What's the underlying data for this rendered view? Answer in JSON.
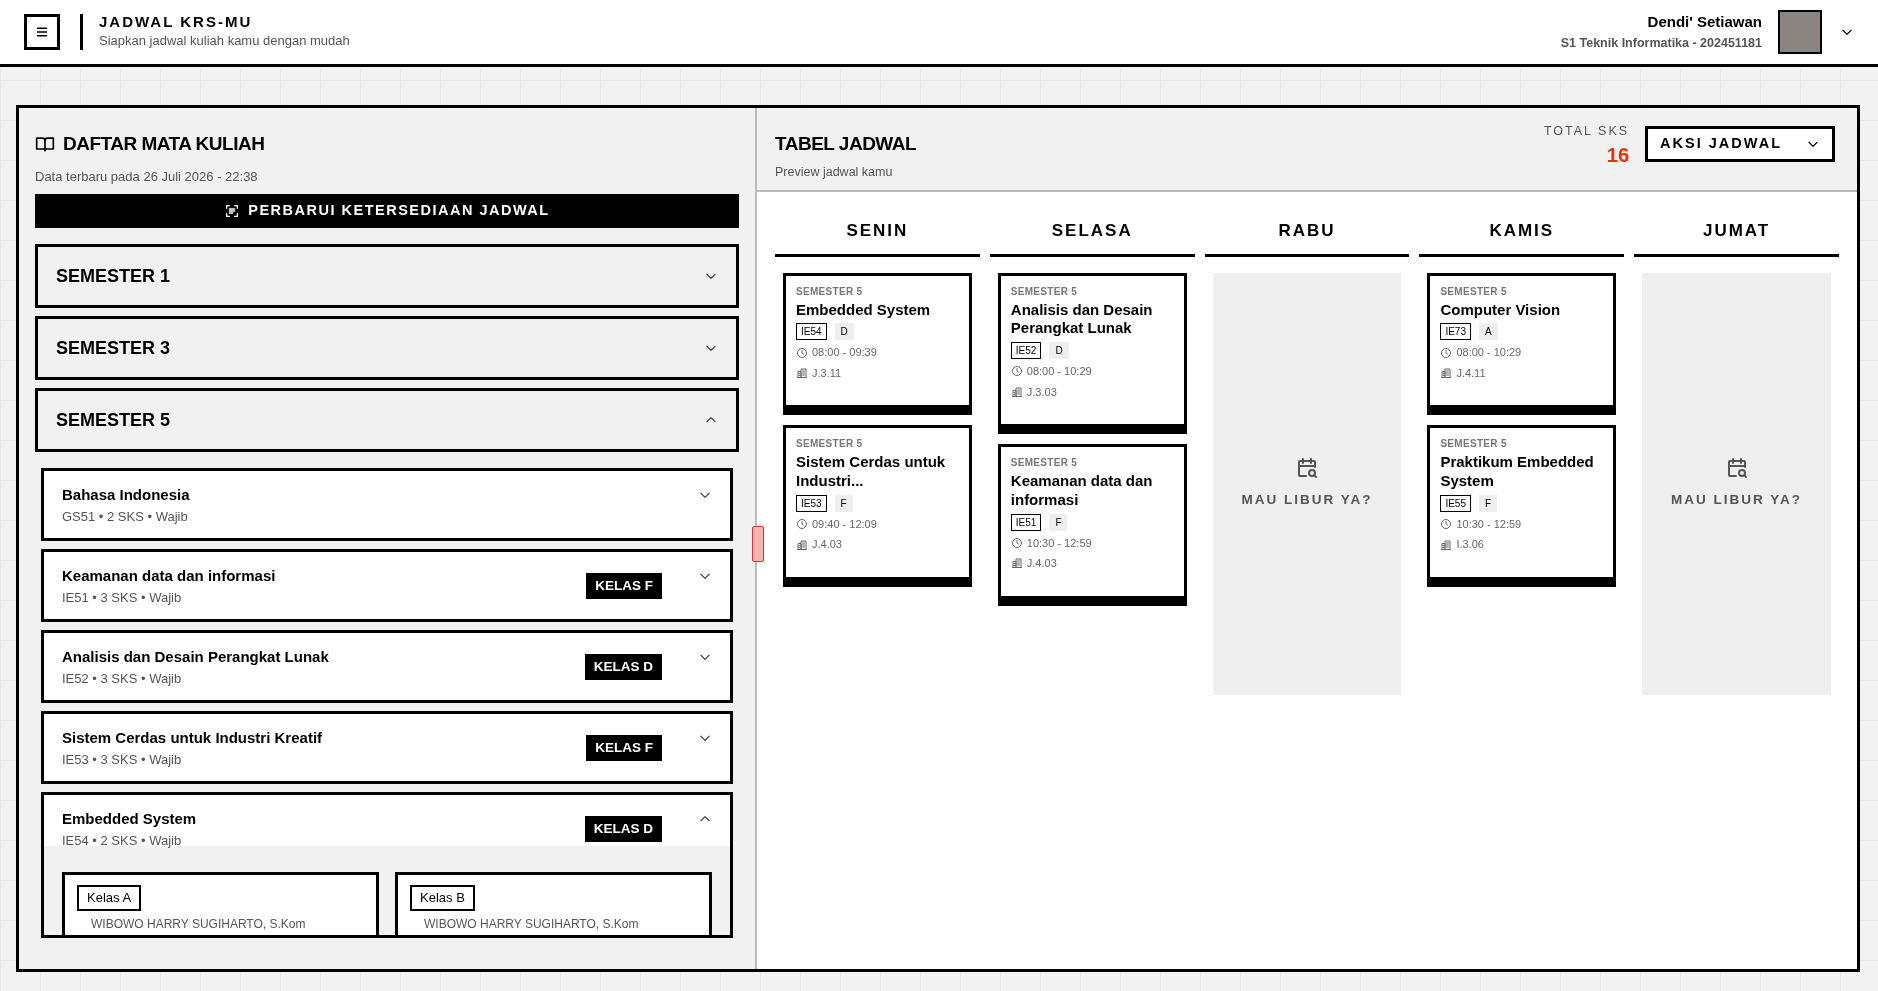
{
  "header": {
    "title": "JADWAL KRS-MU",
    "subtitle": "Siapkan jadwal kuliah kamu dengan mudah",
    "user": {
      "name": "Dendi' Setiawan",
      "program": "S1 Teknik Informatika - 202451181"
    }
  },
  "course_list": {
    "title": "DAFTAR MATA KULIAH",
    "updated": "Data terbaru pada 26 Juli 2026 - 22:38",
    "refresh_button": "PERBARUI KETERSEDIAAN JADWAL",
    "semesters": [
      {
        "label": "SEMESTER 1",
        "expanded": false
      },
      {
        "label": "SEMESTER 3",
        "expanded": false
      },
      {
        "label": "SEMESTER 5",
        "expanded": true,
        "courses": [
          {
            "name": "Bahasa Indonesia",
            "meta": "GS51 • 2 SKS • Wajib",
            "expanded": false
          },
          {
            "name": "Keamanan data dan informasi",
            "meta": "IE51 • 3 SKS • Wajib",
            "badge": "KELAS F",
            "expanded": false
          },
          {
            "name": "Analisis dan Desain Perangkat Lunak",
            "meta": "IE52 • 3 SKS • Wajib",
            "badge": "KELAS D",
            "expanded": false
          },
          {
            "name": "Sistem Cerdas untuk Industri Kreatif",
            "meta": "IE53 • 3 SKS • Wajib",
            "badge": "KELAS F",
            "expanded": false
          },
          {
            "name": "Embedded System",
            "meta": "IE54 • 2 SKS • Wajib",
            "badge": "KELAS D",
            "expanded": true,
            "classes": [
              {
                "label": "Kelas A",
                "lecturer": "WIBOWO HARRY SUGIHARTO, S.Kom"
              },
              {
                "label": "Kelas B",
                "lecturer": "WIBOWO HARRY SUGIHARTO, S.Kom"
              }
            ]
          }
        ]
      }
    ]
  },
  "schedule": {
    "title": "TABEL JADWAL",
    "subtitle": "Preview jadwal kamu",
    "total_label": "TOTAL SKS",
    "total_value": "16",
    "action_button": "AKSI JADWAL",
    "days": [
      {
        "name": "SENIN",
        "sessions": [
          {
            "semester": "SEMESTER 5",
            "name": "Embedded System",
            "code": "IE54",
            "class": "D",
            "time": "08:00 - 09:39",
            "room": "J.3.11"
          },
          {
            "semester": "SEMESTER 5",
            "name": "Sistem Cerdas untuk Industri...",
            "code": "IE53",
            "class": "F",
            "time": "09:40 - 12:09",
            "room": "J.4.03"
          }
        ]
      },
      {
        "name": "SELASA",
        "sessions": [
          {
            "semester": "SEMESTER 5",
            "name": "Analisis dan Desain Perangkat Lunak",
            "code": "IE52",
            "class": "D",
            "time": "08:00 - 10:29",
            "room": "J.3.03"
          },
          {
            "semester": "SEMESTER 5",
            "name": "Keamanan data dan informasi",
            "code": "IE51",
            "class": "F",
            "time": "10:30 - 12:59",
            "room": "J.4.03"
          }
        ]
      },
      {
        "name": "RABU",
        "empty_text": "MAU LIBUR YA?"
      },
      {
        "name": "KAMIS",
        "sessions": [
          {
            "semester": "SEMESTER 5",
            "name": "Computer Vision",
            "code": "IE73",
            "class": "A",
            "time": "08:00 - 10:29",
            "room": "J.4.11"
          },
          {
            "semester": "SEMESTER 5",
            "name": "Praktikum Embedded System",
            "code": "IE55",
            "class": "F",
            "time": "10:30 - 12:59",
            "room": "I.3.06"
          }
        ]
      },
      {
        "name": "JUMAT",
        "empty_text": "MAU LIBUR YA?"
      }
    ]
  }
}
